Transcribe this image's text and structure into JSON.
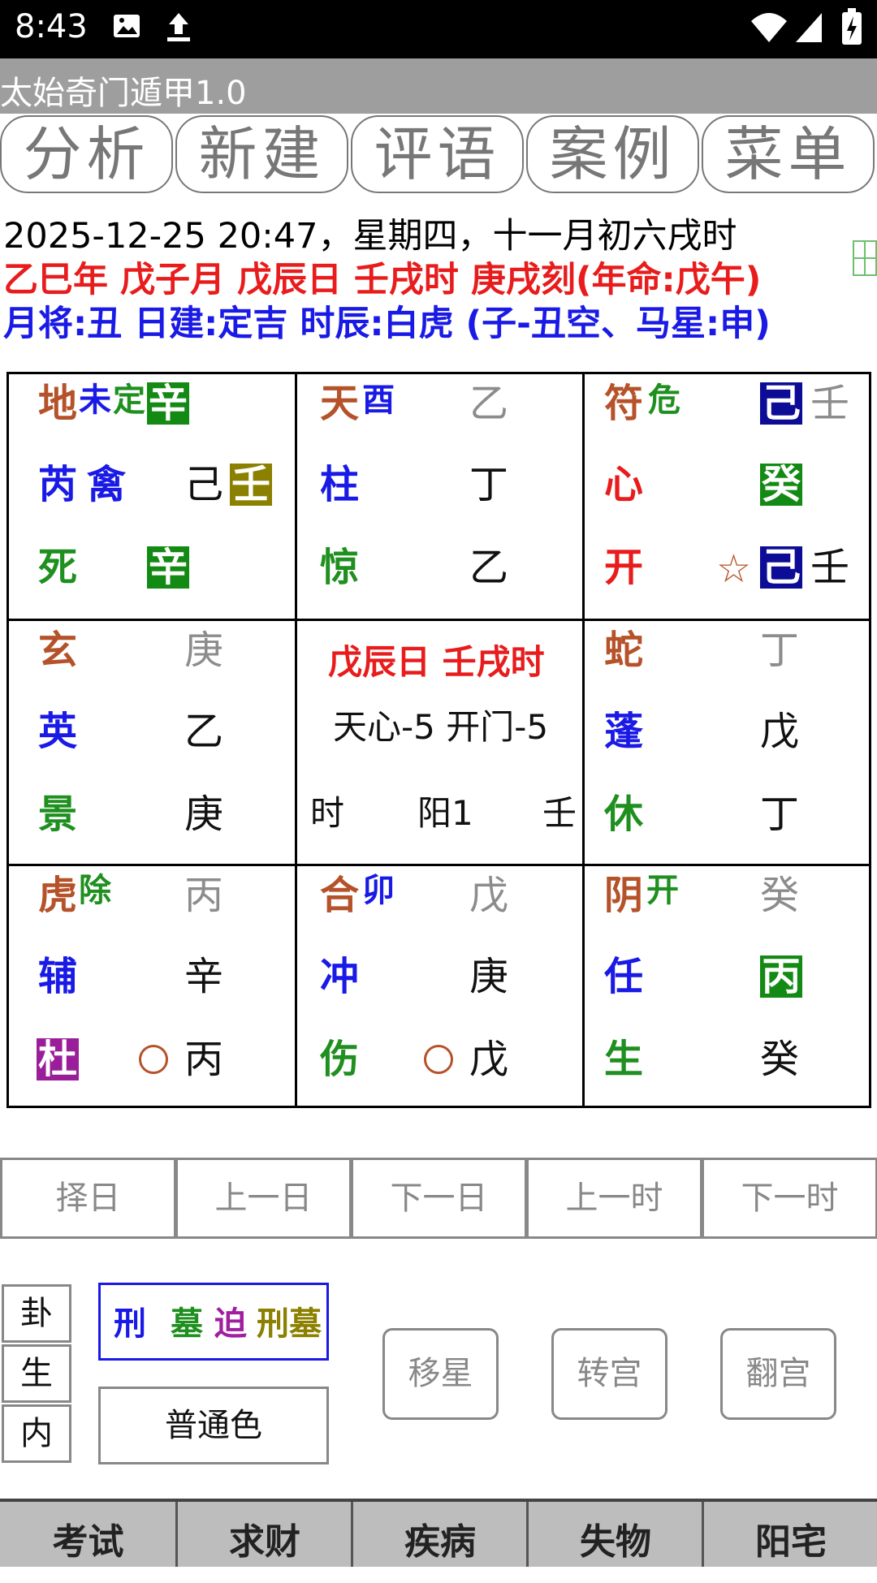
{
  "status_bar": {
    "time": "8:43"
  },
  "app": {
    "title": "太始奇门遁甲1.0"
  },
  "tabs": [
    "分析",
    "新建",
    "评语",
    "案例",
    "菜单"
  ],
  "info": {
    "line1": "2025-12-25 20:47，星期四，十一月初六戌时",
    "line2": "乙巳年  戊子月  戊辰日  壬戌时  庚戌刻(年命:戊午)",
    "line3": "月将:丑 日建:定吉 时辰:白虎 (子-丑空、马星:申)"
  },
  "grid": {
    "c00": {
      "god": "地",
      "b1": "未",
      "b2": "定",
      "tian_gan": "辛",
      "star": "芮",
      "star2": "禽",
      "di_gan": "己",
      "di_gan2": "壬",
      "door": "死",
      "door_gan": "辛"
    },
    "c01": {
      "god": "天",
      "b1": "酉",
      "tian_gan": "乙",
      "star": "柱",
      "di_gan": "丁",
      "door": "惊",
      "door_gan": "乙"
    },
    "c02": {
      "god": "符",
      "b2": "危",
      "tian_gan": "己",
      "tian_gan2": "壬",
      "star": "心",
      "di_gan": "癸",
      "door": "开",
      "mark": "☆",
      "door_gan": "己",
      "door_gan2": "壬"
    },
    "c10": {
      "god": "玄",
      "tian_gan": "庚",
      "star": "英",
      "di_gan": "乙",
      "door": "景",
      "door_gan": "庚"
    },
    "center": {
      "line1": "戊辰日 壬戌时",
      "line2": "天心-5 开门-5",
      "left": "时",
      "mid": "阳1",
      "right": "壬"
    },
    "c12": {
      "god": "蛇",
      "tian_gan": "丁",
      "star": "蓬",
      "di_gan": "戊",
      "door": "休",
      "door_gan": "丁"
    },
    "c20": {
      "god": "虎",
      "b2": "除",
      "tian_gan": "丙",
      "star": "辅",
      "di_gan": "辛",
      "door": "杜",
      "door_gan": "丙"
    },
    "c21": {
      "god": "合",
      "b1": "卯",
      "tian_gan": "戊",
      "star": "冲",
      "di_gan": "庚",
      "door": "伤",
      "door_gan": "戊"
    },
    "c22": {
      "god": "阴",
      "b2": "开",
      "tian_gan": "癸",
      "star": "任",
      "di_gan": "丙",
      "door": "生",
      "door_gan": "癸"
    }
  },
  "nav": [
    "择日",
    "上一日",
    "下一日",
    "上一时",
    "下一时"
  ],
  "side": [
    "卦",
    "生",
    "内"
  ],
  "legend": {
    "xing": "刑",
    "mu": "墓",
    "po": "迫",
    "xingmu": "刑墓"
  },
  "color_mode": "普通色",
  "ops": [
    "移星",
    "转宫",
    "翻宫"
  ],
  "bottom_tabs": [
    "考试",
    "求财",
    "疾病",
    "失物",
    "阳宅"
  ]
}
